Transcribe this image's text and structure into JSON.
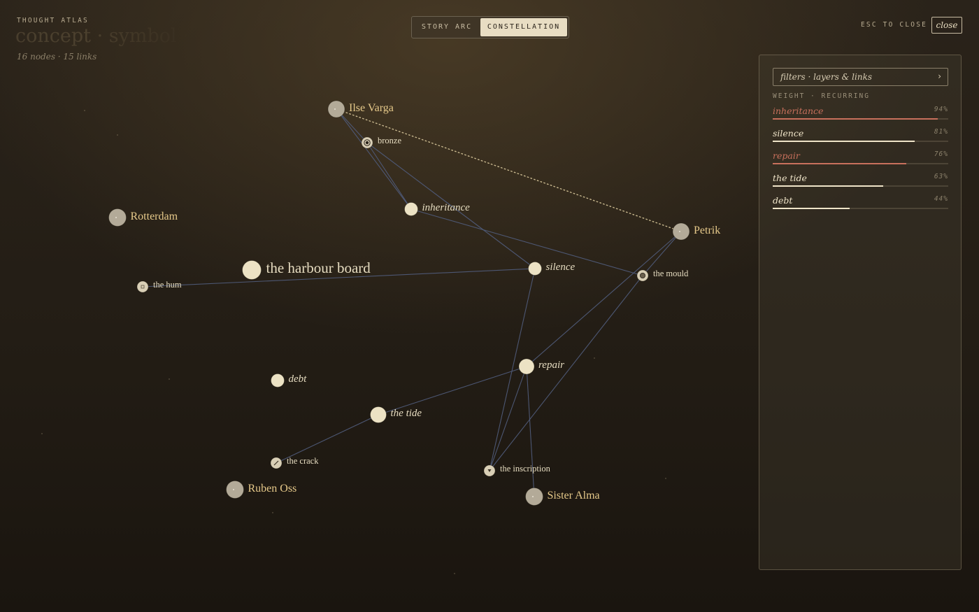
{
  "header": {
    "brand": "THOUGHT ATLAS",
    "title": "concept · symbol · thread",
    "stats": "16 nodes · 15 links",
    "view_toggle": {
      "options": [
        "STORY ARC",
        "CONSTELLATION"
      ],
      "active": "CONSTELLATION"
    },
    "esc_hint": "ESC TO CLOSE",
    "close_label": "close"
  },
  "panel": {
    "filters_label": "filters · layers & links",
    "filters_chevron": "›",
    "section_label": "WEIGHT · RECURRING",
    "weights": [
      {
        "name": "inheritance",
        "percent": 94,
        "label": "94%",
        "color": "#c8705c"
      },
      {
        "name": "silence",
        "percent": 81,
        "label": "81%",
        "color": "#efe4c8"
      },
      {
        "name": "repair",
        "percent": 76,
        "label": "76%",
        "color": "#c8705c"
      },
      {
        "name": "the tide",
        "percent": 63,
        "label": "63%",
        "color": "#efe4c8"
      },
      {
        "name": "debt",
        "percent": 44,
        "label": "44%",
        "color": "#efe4c8"
      }
    ]
  },
  "graph": {
    "colors": {
      "person": "#b3aa98",
      "concept": "#ece2c4",
      "symbol": "#d9cfb6",
      "person_label": "#e6c98a",
      "concept_label": "#e6dcc0",
      "link": "#4f5a78",
      "dotted_link": "#c9b98f"
    },
    "nodes": [
      {
        "id": "ilse",
        "label": "Ilse Varga",
        "kind": "person"
      },
      {
        "id": "bronze",
        "label": "bronze",
        "kind": "symbol",
        "icon": "bronze-icon"
      },
      {
        "id": "inheritance",
        "label": "inheritance",
        "kind": "concept"
      },
      {
        "id": "rotterdam",
        "label": "Rotterdam",
        "kind": "person"
      },
      {
        "id": "petrik",
        "label": "Petrik",
        "kind": "person"
      },
      {
        "id": "harbour",
        "label": "the harbour board",
        "kind": "concept-large"
      },
      {
        "id": "hum",
        "label": "the hum",
        "kind": "symbol",
        "icon": "hum-icon"
      },
      {
        "id": "silence",
        "label": "silence",
        "kind": "concept"
      },
      {
        "id": "mould",
        "label": "the mould",
        "kind": "symbol",
        "icon": "mould-icon"
      },
      {
        "id": "repair",
        "label": "repair",
        "kind": "concept"
      },
      {
        "id": "debt",
        "label": "debt",
        "kind": "concept"
      },
      {
        "id": "tide",
        "label": "the tide",
        "kind": "concept"
      },
      {
        "id": "crack",
        "label": "the crack",
        "kind": "symbol",
        "icon": "crack-icon"
      },
      {
        "id": "ruben",
        "label": "Ruben Oss",
        "kind": "person"
      },
      {
        "id": "inscription",
        "label": "the inscription",
        "kind": "symbol",
        "icon": "inscription-icon"
      },
      {
        "id": "alma",
        "label": "Sister Alma",
        "kind": "person"
      }
    ],
    "links": [
      {
        "from": "ilse",
        "to": "bronze",
        "style": "solid"
      },
      {
        "from": "ilse",
        "to": "inheritance",
        "style": "solid"
      },
      {
        "from": "bronze",
        "to": "inheritance",
        "style": "solid"
      },
      {
        "from": "bronze",
        "to": "silence",
        "style": "solid"
      },
      {
        "from": "inheritance",
        "to": "mould",
        "style": "solid"
      },
      {
        "from": "ilse",
        "to": "petrik",
        "style": "dotted"
      },
      {
        "from": "petrik",
        "to": "repair",
        "style": "solid"
      },
      {
        "from": "hum",
        "to": "silence",
        "style": "solid"
      },
      {
        "from": "silence",
        "to": "inscription",
        "style": "solid"
      },
      {
        "from": "mould",
        "to": "inscription",
        "style": "solid"
      },
      {
        "from": "repair",
        "to": "tide",
        "style": "solid"
      },
      {
        "from": "tide",
        "to": "crack",
        "style": "solid"
      },
      {
        "from": "repair",
        "to": "alma",
        "style": "solid"
      },
      {
        "from": "repair",
        "to": "inscription",
        "style": "solid"
      },
      {
        "from": "petrik",
        "to": "mould",
        "style": "solid"
      }
    ]
  }
}
